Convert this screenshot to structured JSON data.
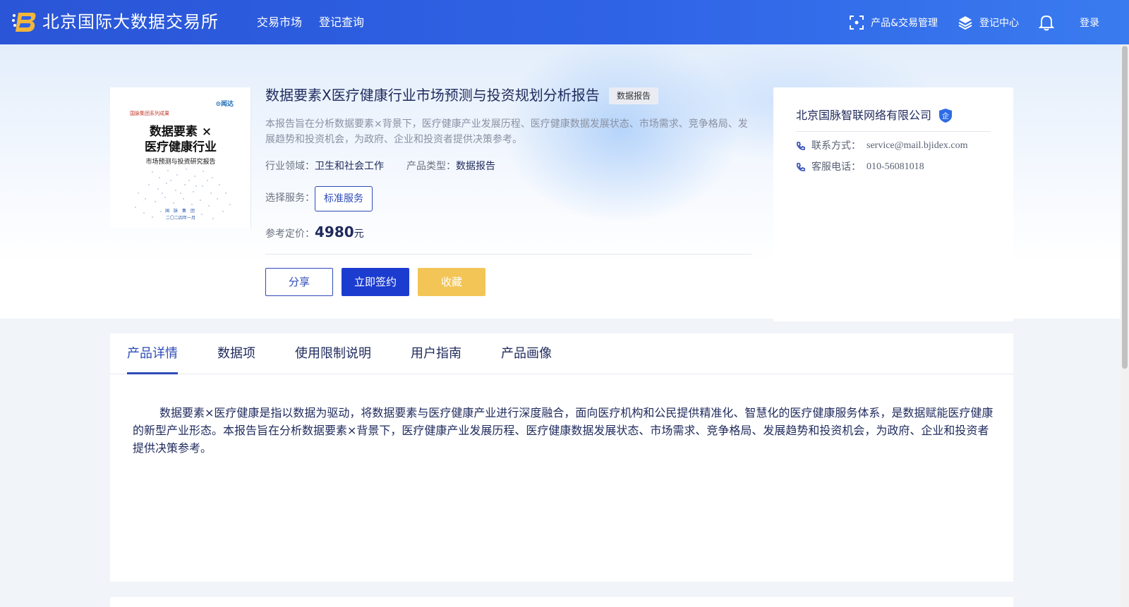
{
  "header": {
    "brand": "北京国际大数据交易所",
    "nav": [
      "交易市场",
      "登记查询"
    ],
    "product_mgmt": "产品&交易管理",
    "reg_center": "登记中心",
    "login": "登录"
  },
  "product": {
    "cover": {
      "publisher": "⊙闻达",
      "series": "国脉集团系列成果",
      "title_line1": "数据要素 ×",
      "title_line2": "医疗健康行业",
      "subtitle": "市场预测与投资研究报告",
      "footer1": "国 脉 集 团",
      "footer2": "二〇二四年一月"
    },
    "title": "数据要素X医疗健康行业市场预测与投资规划分析报告",
    "tag": "数据报告",
    "description": "本报告旨在分析数据要素×背景下，医疗健康产业发展历程、医疗健康数据发展状态、市场需求、竞争格局、发展趋势和投资机会，为政府、企业和投资者提供决策参考。",
    "industry_label": "行业领域：",
    "industry": "卫生和社会工作",
    "type_label": "产品类型：",
    "type": "数据报告",
    "service_label": "选择服务：",
    "service": "标准服务",
    "price_label": "参考定价：",
    "price": "4980",
    "price_unit": "元",
    "buttons": {
      "share": "分享",
      "sign": "立即签约",
      "favorite": "收藏"
    }
  },
  "company": {
    "name": "北京国脉智联网络有限公司",
    "badge": "企",
    "contact_label": "联系方式：",
    "contact": "service@mail.bjidex.com",
    "phone_label": "客服电话：",
    "phone": "010-56081018"
  },
  "tabs": [
    "产品详情",
    "数据项",
    "使用限制说明",
    "用户指南",
    "产品画像"
  ],
  "detail": {
    "text": "数据要素×医疗健康是指以数据为驱动，将数据要素与医疗健康产业进行深度融合，面向医疗机构和公民提供精准化、智慧化的医疗健康服务体系，是数据赋能医疗健康的新型产业形态。本报告旨在分析数据要素×背景下，医疗健康产业发展历程、医疗健康数据发展状态、市场需求、竞争格局、发展趋势和投资机会，为政府、企业和投资者提供决策参考。"
  },
  "colors": {
    "header_start": "#2a55d6",
    "header_end": "#3a7bef",
    "primary": "#1c3ccf",
    "favorite": "#f3c557",
    "text_dark": "#1f2a5c"
  }
}
